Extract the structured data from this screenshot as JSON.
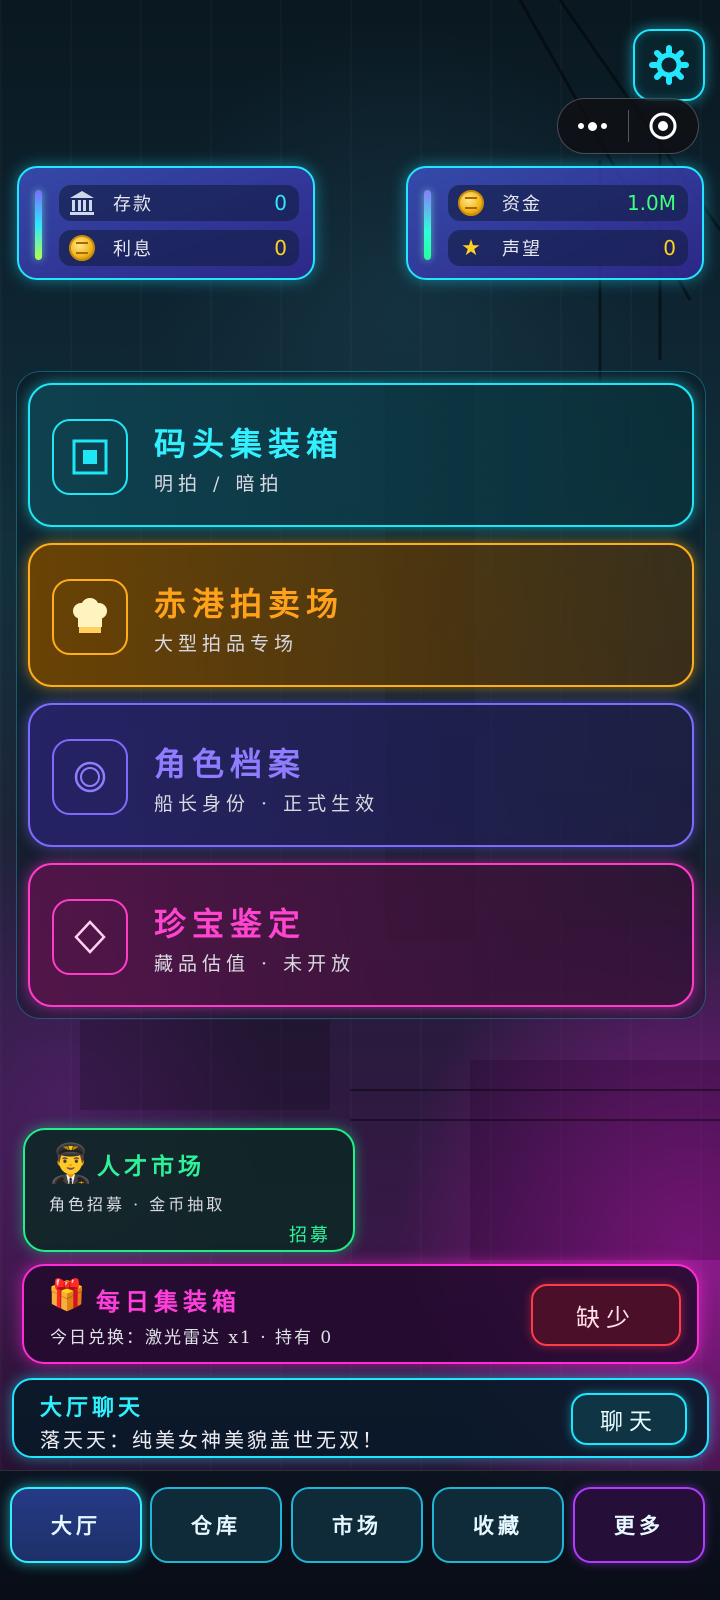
{
  "stats_left": {
    "deposit": {
      "label": "存款",
      "value": "0",
      "icon": "bank-icon",
      "color": "#2ee8ff"
    },
    "interest": {
      "label": "利息",
      "value": "0",
      "icon": "coin-icon",
      "color": "#ffd21e"
    }
  },
  "stats_right": {
    "funds": {
      "label": "资金",
      "value": "1.0M",
      "icon": "coin-icon",
      "color": "#3dff7a"
    },
    "reputation": {
      "label": "声望",
      "value": "0",
      "icon": "star-icon",
      "color": "#ffd21e"
    }
  },
  "menu": {
    "dock": {
      "title": "码头集装箱",
      "subtitle": "明拍 / 暗拍"
    },
    "auction": {
      "title": "赤港拍卖场",
      "subtitle": "大型拍品专场"
    },
    "role": {
      "title": "角色档案",
      "subtitle": "船长身份 · 正式生效"
    },
    "treasure": {
      "title": "珍宝鉴定",
      "subtitle": "藏品估值 · 未开放"
    }
  },
  "talent": {
    "title": "人才市场",
    "subtitle": "角色招募 · 金币抽取",
    "action": "招募"
  },
  "daily": {
    "title": "每日集装箱",
    "subtitle": "今日兑换：激光雷达 x1 · 持有 0",
    "button": "缺少"
  },
  "chat": {
    "title": "大厅聊天",
    "message": "落天天：纯美女神美貌盖世无双！",
    "button": "聊天"
  },
  "nav": {
    "hall": "大厅",
    "warehouse": "仓库",
    "market": "市场",
    "collection": "收藏",
    "more": "更多"
  },
  "colors": {
    "accent_cyan": "#1ee6ff",
    "accent_orange": "#ffad1a",
    "accent_purple": "#7d6bff",
    "accent_pink": "#ff3cc8",
    "accent_green": "#1ef08a"
  }
}
